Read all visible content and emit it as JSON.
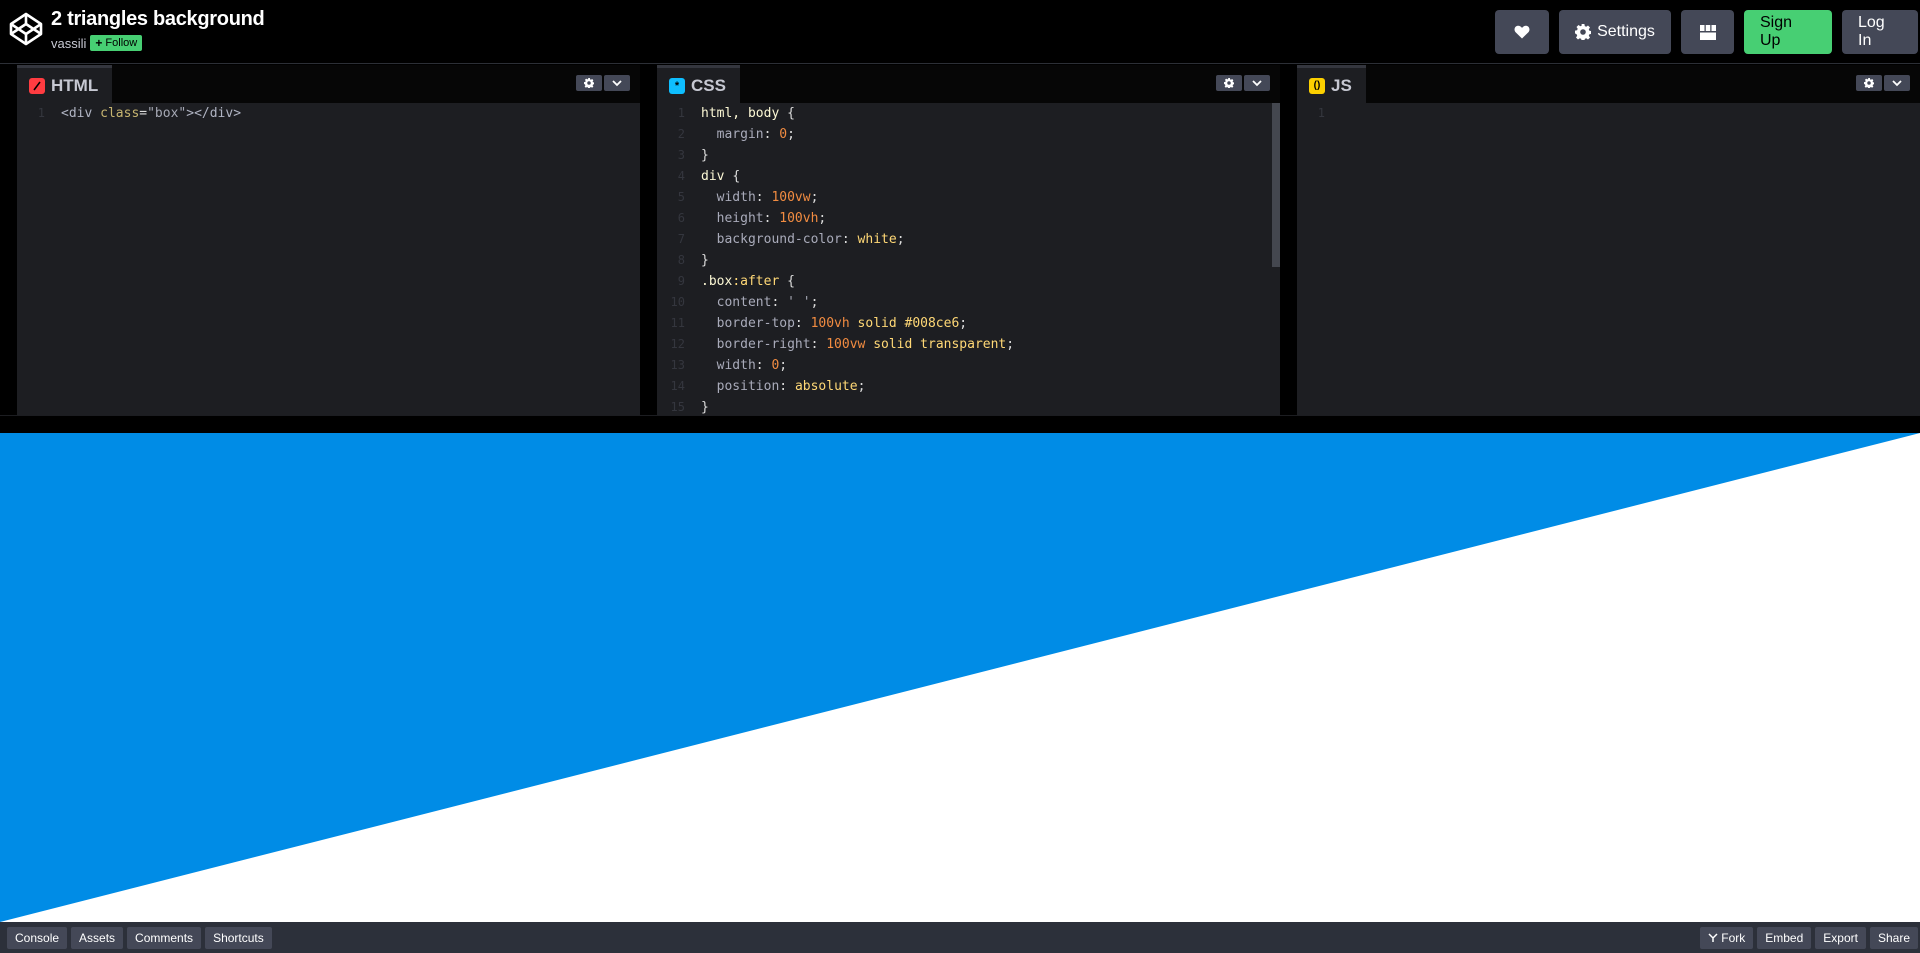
{
  "header": {
    "title": "2 triangles background",
    "author": "vassili",
    "follow_label": "Follow",
    "settings_label": "Settings",
    "signup_label": "Sign Up",
    "login_label": "Log In"
  },
  "editors": {
    "html": {
      "label": "HTML",
      "icon_color": "#ff3c41",
      "lines": [
        {
          "n": "1",
          "tokens": [
            [
              "t-tag",
              "<div "
            ],
            [
              "t-attr",
              "class"
            ],
            [
              "t-pun",
              "="
            ],
            [
              "t-str",
              "\"box\""
            ],
            [
              "t-tag",
              "></div>"
            ]
          ]
        }
      ]
    },
    "css": {
      "label": "CSS",
      "icon_color": "#0ebeff",
      "lines": [
        {
          "n": "1",
          "tokens": [
            [
              "t-sel",
              "html, body "
            ],
            [
              "t-pun",
              "{"
            ]
          ]
        },
        {
          "n": "2",
          "tokens": [
            [
              "t-prop",
              "  margin"
            ],
            [
              "t-pun",
              ": "
            ],
            [
              "t-num",
              "0"
            ],
            [
              "t-pun",
              ";"
            ]
          ]
        },
        {
          "n": "3",
          "tokens": [
            [
              "t-pun",
              "}"
            ]
          ]
        },
        {
          "n": "4",
          "tokens": [
            [
              "t-sel",
              "div "
            ],
            [
              "t-pun",
              "{"
            ]
          ]
        },
        {
          "n": "5",
          "tokens": [
            [
              "t-prop",
              "  width"
            ],
            [
              "t-pun",
              ": "
            ],
            [
              "t-num",
              "100vw"
            ],
            [
              "t-pun",
              ";"
            ]
          ]
        },
        {
          "n": "6",
          "tokens": [
            [
              "t-prop",
              "  height"
            ],
            [
              "t-pun",
              ": "
            ],
            [
              "t-num",
              "100vh"
            ],
            [
              "t-pun",
              ";"
            ]
          ]
        },
        {
          "n": "7",
          "tokens": [
            [
              "t-prop",
              "  background-color"
            ],
            [
              "t-pun",
              ": "
            ],
            [
              "t-val",
              "white"
            ],
            [
              "t-pun",
              ";"
            ]
          ]
        },
        {
          "n": "8",
          "tokens": [
            [
              "t-pun",
              "}"
            ]
          ]
        },
        {
          "n": "9",
          "tokens": [
            [
              "t-sel",
              ".box"
            ],
            [
              "t-val",
              ":after "
            ],
            [
              "t-pun",
              "{"
            ]
          ]
        },
        {
          "n": "10",
          "tokens": [
            [
              "t-prop",
              "  content"
            ],
            [
              "t-pun",
              ": "
            ],
            [
              "t-str",
              "' '"
            ],
            [
              "t-pun",
              ";"
            ]
          ]
        },
        {
          "n": "11",
          "tokens": [
            [
              "t-prop",
              "  border-top"
            ],
            [
              "t-pun",
              ": "
            ],
            [
              "t-num",
              "100vh"
            ],
            [
              "t-val",
              " solid #008ce6"
            ],
            [
              "t-pun",
              ";"
            ]
          ]
        },
        {
          "n": "12",
          "tokens": [
            [
              "t-prop",
              "  border-right"
            ],
            [
              "t-pun",
              ": "
            ],
            [
              "t-num",
              "100vw"
            ],
            [
              "t-val",
              " solid transparent"
            ],
            [
              "t-pun",
              ";"
            ]
          ]
        },
        {
          "n": "13",
          "tokens": [
            [
              "t-prop",
              "  width"
            ],
            [
              "t-pun",
              ": "
            ],
            [
              "t-num",
              "0"
            ],
            [
              "t-pun",
              ";"
            ]
          ]
        },
        {
          "n": "14",
          "tokens": [
            [
              "t-prop",
              "  position"
            ],
            [
              "t-pun",
              ": "
            ],
            [
              "t-val",
              "absolute"
            ],
            [
              "t-pun",
              ";"
            ]
          ]
        },
        {
          "n": "15",
          "tokens": [
            [
              "t-pun",
              "}"
            ]
          ]
        }
      ]
    },
    "js": {
      "label": "JS",
      "icon_color": "#fcd000",
      "lines": [
        {
          "n": "1",
          "tokens": []
        }
      ]
    }
  },
  "preview": {
    "triangle_color": "#008ce6",
    "background_color": "#ffffff"
  },
  "footer": {
    "left": [
      "Console",
      "Assets",
      "Comments",
      "Shortcuts"
    ],
    "fork_label": "Fork",
    "embed_label": "Embed",
    "export_label": "Export",
    "share_label": "Share"
  }
}
